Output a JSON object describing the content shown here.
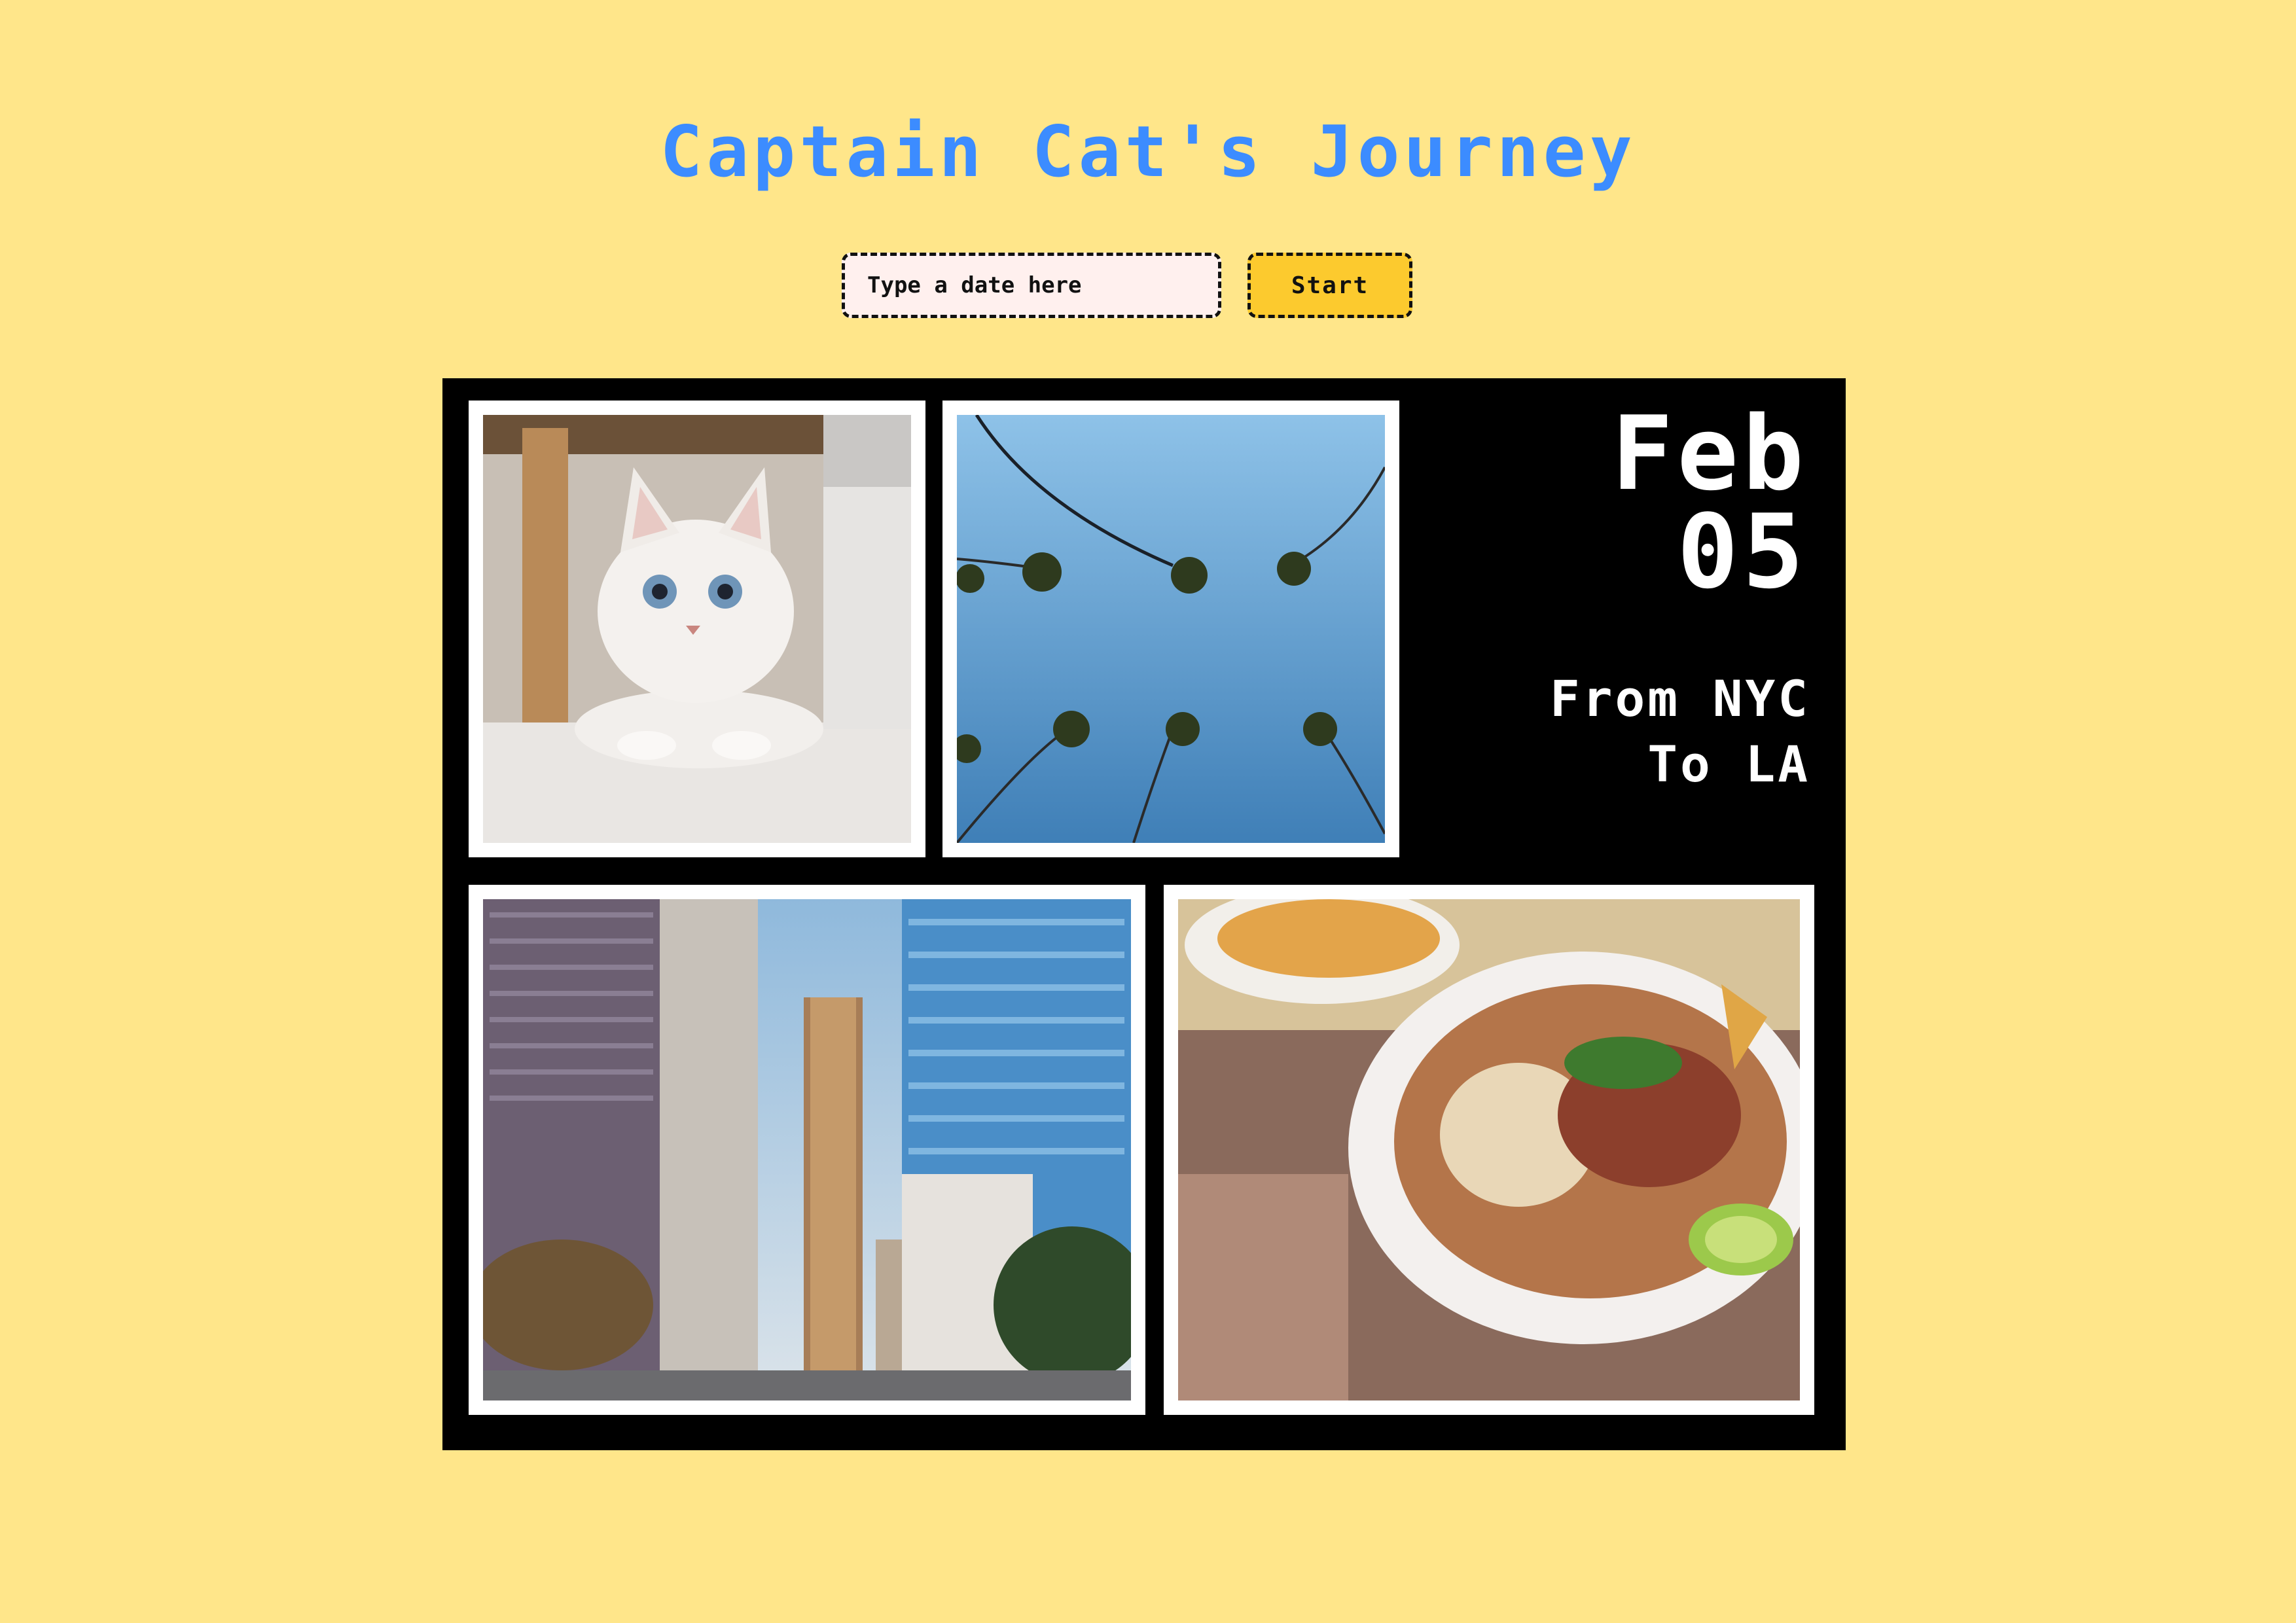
{
  "page": {
    "title": "Captain Cat's Journey",
    "background": "#FFE68A",
    "accent": "#3C8CFF"
  },
  "controls": {
    "date_placeholder": "Type a date here",
    "start_label": "Start",
    "start_color": "#FCCA2E"
  },
  "postcard": {
    "month": "Feb",
    "day": "05",
    "route_from": "From NYC",
    "route_to": "To LA",
    "photos": [
      {
        "subject": "white kitten photo"
      },
      {
        "subject": "palm trees against blue sky photo"
      },
      {
        "subject": "downtown skyscrapers photo"
      },
      {
        "subject": "burrito bowl food photo"
      }
    ]
  }
}
